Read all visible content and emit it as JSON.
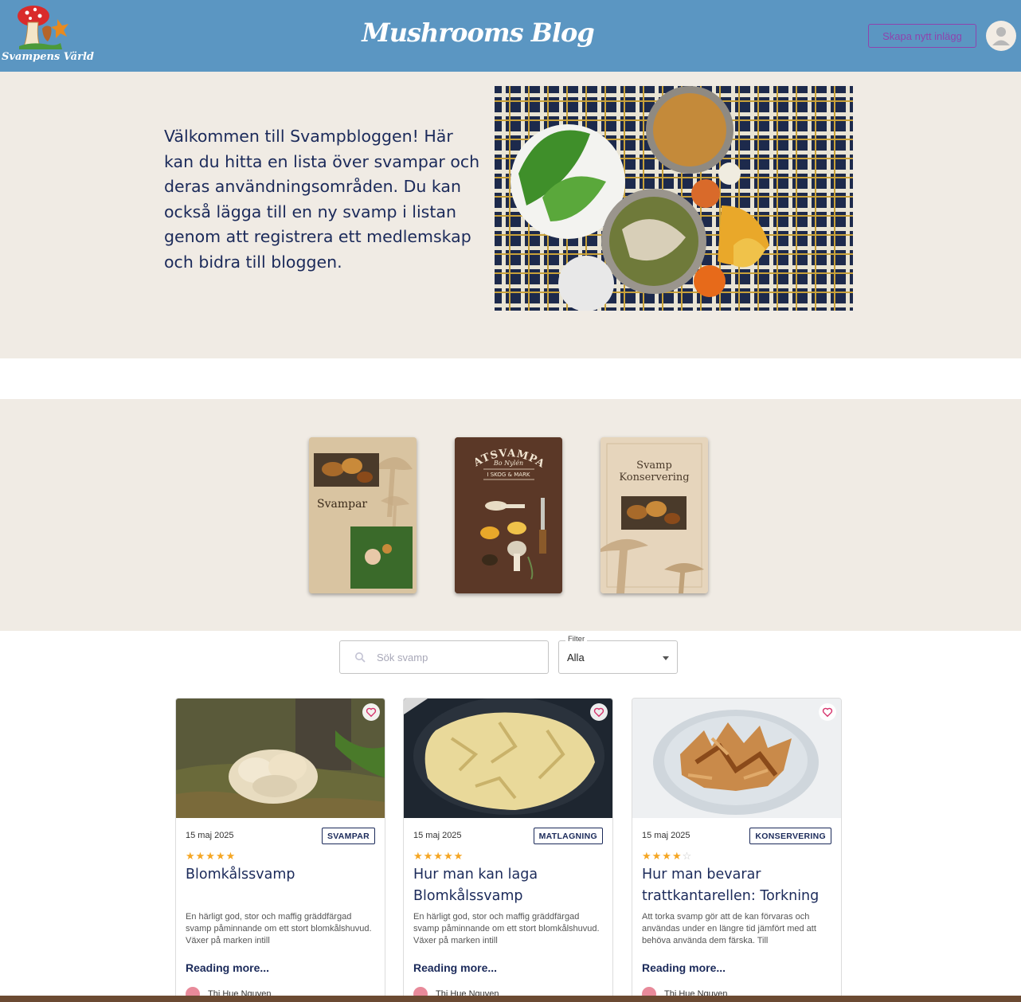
{
  "header": {
    "logo_text": "Svampens Värld",
    "site_title": "Mushrooms Blog",
    "create_post_label": "Skapa nytt inlägg"
  },
  "hero": {
    "text": "Välkommen till Svampbloggen! Här kan du hitta en lista över svampar och deras användningsområden. Du kan också lägga till en ny svamp i listan genom att registrera ett medlemskap och bidra till bloggen."
  },
  "books": [
    {
      "title": "Svampar"
    },
    {
      "title": "MATSVAMPAR",
      "subtitle": "Bo Nylén",
      "ribbon": "I SKOG & MARK"
    },
    {
      "title": "Svamp Konservering"
    }
  ],
  "search": {
    "placeholder": "Sök svamp",
    "value": ""
  },
  "filter": {
    "label": "Filter",
    "value": "Alla"
  },
  "cards": [
    {
      "date": "15 maj 2025",
      "category": "SVAMPAR",
      "rating": 5,
      "stars": "★★★★★",
      "title": "Blomkålssvamp",
      "description": "En härligt god, stor och maffig gräddfärgad svamp påminnande om ett stort blomkålshuvud. Växer på marken intill",
      "more": "Reading more...",
      "author": "Thi Hue Nguyen"
    },
    {
      "date": "15 maj 2025",
      "category": "MATLAGNING",
      "rating": 5,
      "stars": "★★★★★",
      "title": "Hur man kan laga Blomkålssvamp",
      "description": "En härligt god, stor och maffig gräddfärgad svamp påminnande om ett stort blomkålshuvud. Växer på marken intill",
      "more": "Reading more...",
      "author": "Thi Hue Nguyen"
    },
    {
      "date": "15 maj 2025",
      "category": "KONSERVERING",
      "rating": 4,
      "stars_on": "★★★★",
      "stars_off": "☆",
      "title": "Hur man bevarar trattkantarellen: Torkning",
      "description": "Att torka svamp gör att de kan förvaras och användas under en längre tid jämfört med att behöva använda dem färska. Till",
      "more": "Reading more...",
      "author": "Thi Hue Nguyen"
    }
  ],
  "colors": {
    "header_bg": "#5b96c2",
    "hero_bg": "#f0ebe4",
    "accent_purple": "#8e44ad",
    "navy_text": "#1b2a5a",
    "star": "#f5a623",
    "heart": "#d6336c"
  },
  "icons": {
    "logo": "mushroom-logo-icon",
    "avatar": "user-avatar-icon",
    "search": "search-icon",
    "dropdown": "caret-down-icon",
    "favorite": "heart-outline-icon"
  }
}
